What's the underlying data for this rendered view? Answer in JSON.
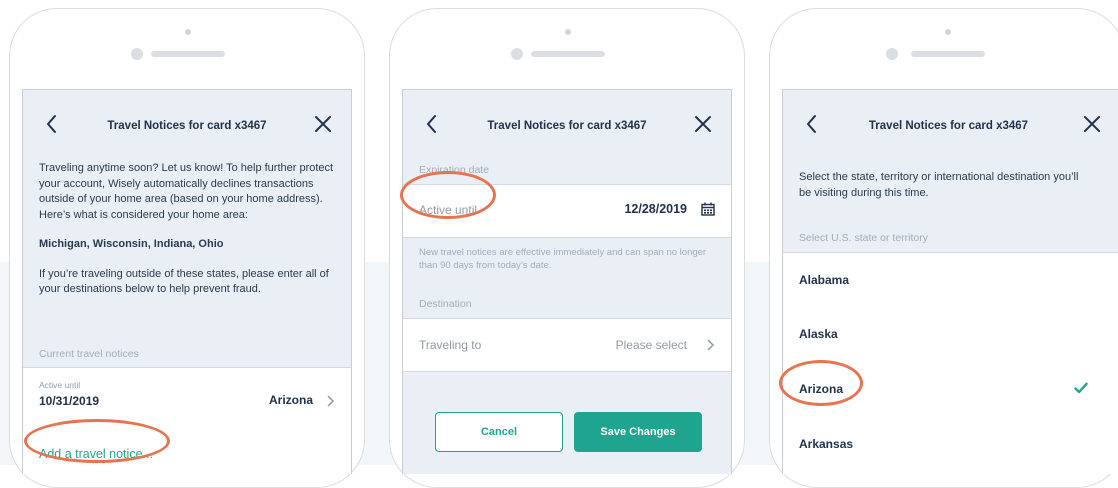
{
  "colors": {
    "accent": "#1fa58f",
    "highlight": "#e8734f",
    "text": "#22324a",
    "muted": "#a2adba"
  },
  "screen1": {
    "title": "Travel Notices for card x3467",
    "intro_text": "Traveling anytime soon? Let us know! To help further protect your account, Wisely automatically declines transactions outside of your home area (based on your home address). Here’s what is considered your home area:",
    "home_states": "Michigan, Wisconsin, Indiana, Ohio",
    "instruction_text": "If you’re traveling outside of these states, please enter all of your destinations below to help prevent fraud.",
    "current_label": "Current travel notices",
    "notice": {
      "label": "Active until",
      "date": "10/31/2019",
      "destination": "Arizona"
    },
    "add_link": "Add a travel notice..."
  },
  "screen2": {
    "title": "Travel Notices for card x3467",
    "expiration_label": "Expiration date",
    "active_label": "Active until",
    "active_value": "12/28/2019",
    "note": "New travel notices are effective immediately and can span no longer than 90 days from today’s date.",
    "destination_label": "Destination",
    "traveling_label": "Traveling to",
    "traveling_placeholder": "Please select",
    "cancel_label": "Cancel",
    "save_label": "Save Changes"
  },
  "screen3": {
    "title": "Travel Notices for card x3467",
    "intro_text": "Select the state, territory or international destination you’ll be visiting during this time.",
    "section_label": "Select U.S. state or territory",
    "states": [
      "Alabama",
      "Alaska",
      "Arizona",
      "Arkansas"
    ],
    "selected_state": "Arizona"
  },
  "icons": [
    "back-chevron-icon",
    "close-icon",
    "chevron-right-icon",
    "calendar-icon",
    "checkmark-icon"
  ]
}
